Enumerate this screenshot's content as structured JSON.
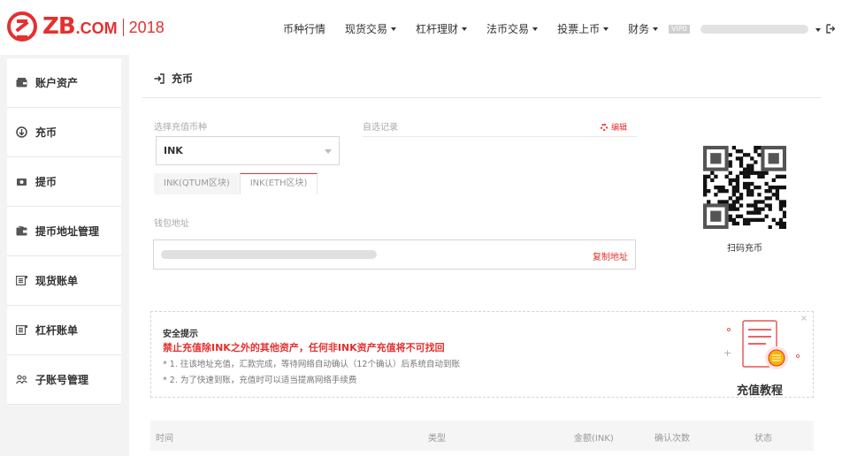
{
  "header": {
    "logo": {
      "brand": "ZB",
      "domain": ".COM",
      "year": "2018"
    },
    "nav": [
      {
        "label": "币种行情",
        "dropdown": false
      },
      {
        "label": "现货交易",
        "dropdown": true
      },
      {
        "label": "杠杆理财",
        "dropdown": true
      },
      {
        "label": "法币交易",
        "dropdown": true
      },
      {
        "label": "投票上币",
        "dropdown": true
      },
      {
        "label": "财务",
        "dropdown": true
      }
    ],
    "vip_badge": "VIP0",
    "logout_icon": "logout-icon"
  },
  "sidebar": {
    "items": [
      {
        "label": "账户资产",
        "icon": "wallet-icon"
      },
      {
        "label": "充币",
        "icon": "deposit-icon"
      },
      {
        "label": "提币",
        "icon": "withdraw-icon"
      },
      {
        "label": "提币地址管理",
        "icon": "address-book-icon"
      },
      {
        "label": "现货账单",
        "icon": "bill-icon"
      },
      {
        "label": "杠杆账单",
        "icon": "bill-icon"
      },
      {
        "label": "子账号管理",
        "icon": "users-icon"
      }
    ]
  },
  "main": {
    "title": "充币",
    "currency_label": "选择充值币种",
    "currency_value": "INK",
    "chain_tabs": [
      {
        "label": "INK(QTUM区块)",
        "active": false
      },
      {
        "label": "INK(ETH区块)",
        "active": true
      }
    ],
    "custom_record_label": "自选记录",
    "edit_label": "编辑",
    "wallet_label": "钱包地址",
    "copy_label": "复制地址",
    "qr_label": "扫码充币",
    "notice": {
      "title": "安全提示",
      "warning": "禁止充值除INK之外的其他资产，任何非INK资产充值将不可找回",
      "lines": [
        "* 1. 往该地址充值，汇款完成，等待网络自动确认（12个确认）后系统自动到账",
        "* 2. 为了快速到账，充值时可以适当提高网络手续费"
      ],
      "close": "×",
      "tutorial_label": "充值教程"
    },
    "table": {
      "columns": [
        "时间",
        "类型",
        "金额(INK)",
        "确认次数",
        "状态"
      ]
    }
  },
  "colors": {
    "accent": "#e4302f",
    "muted": "#aaaaaa",
    "border": "#d6d6d6"
  }
}
